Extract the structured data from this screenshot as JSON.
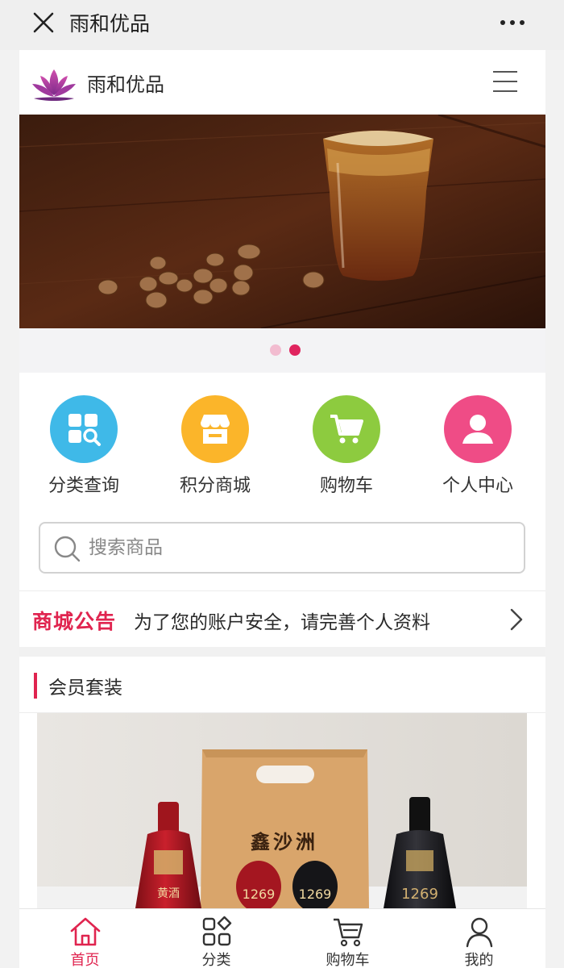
{
  "wechat": {
    "title": "雨和优品"
  },
  "header": {
    "brand": "雨和优品"
  },
  "quick_links": [
    {
      "label": "分类查询",
      "icon": "category-search-icon",
      "color": "#3fb9e8"
    },
    {
      "label": "积分商城",
      "icon": "store-icon",
      "color": "#fbb52a"
    },
    {
      "label": "购物车",
      "icon": "cart-icon",
      "color": "#8dcb3f"
    },
    {
      "label": "个人中心",
      "icon": "user-icon",
      "color": "#ef4c86"
    }
  ],
  "search": {
    "placeholder": "搜索商品"
  },
  "notice": {
    "tag": "商城公告",
    "text": "为了您的账户安全，请完善个人资料"
  },
  "section": {
    "title": "会员套装"
  },
  "product": {
    "box_text": "鑫沙洲",
    "bottle_number": "1269",
    "bottle_label": "黄酒"
  },
  "tabbar": [
    {
      "label": "首页",
      "icon": "home-icon",
      "active": true
    },
    {
      "label": "分类",
      "icon": "category-icon",
      "active": false
    },
    {
      "label": "购物车",
      "icon": "cart-icon",
      "active": false
    },
    {
      "label": "我的",
      "icon": "profile-icon",
      "active": false
    }
  ],
  "colors": {
    "accent": "#e0244f"
  }
}
